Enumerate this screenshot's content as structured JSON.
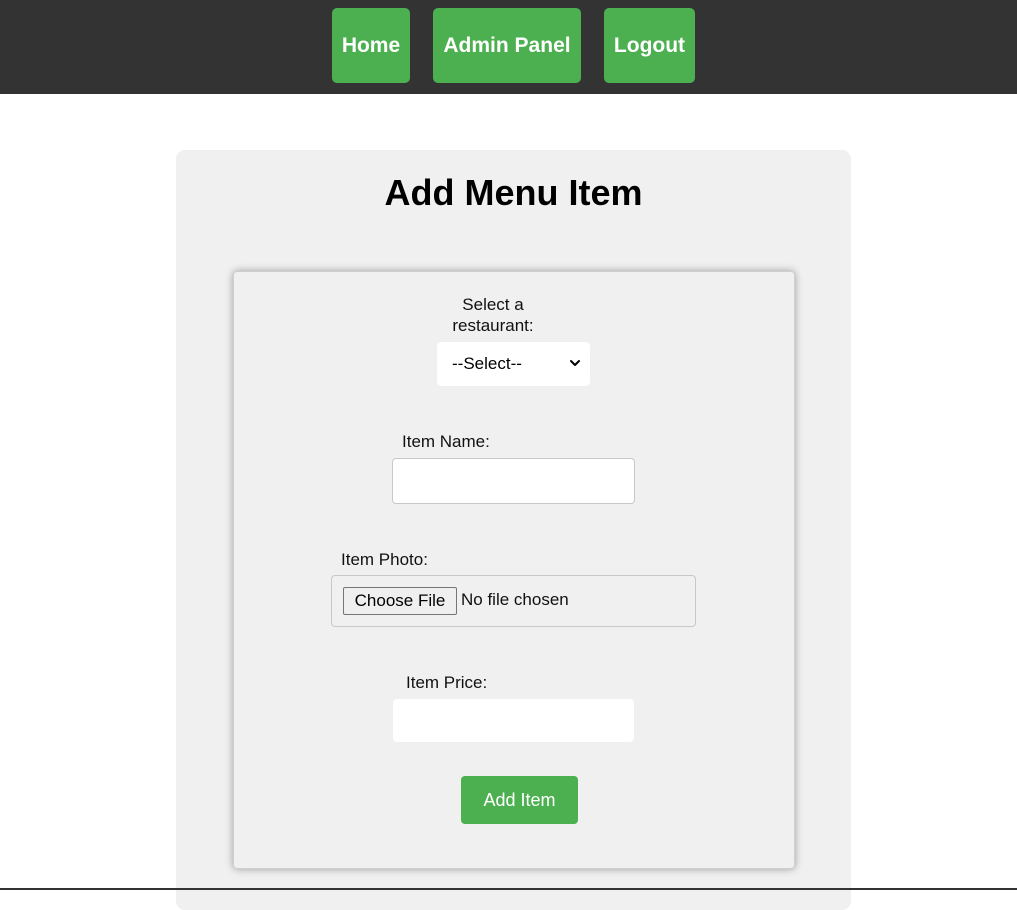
{
  "nav": {
    "items": [
      {
        "label": "Home"
      },
      {
        "label": "Admin Panel"
      },
      {
        "label": "Logout"
      }
    ],
    "accent_color": "#4caf50",
    "background_color": "#333333"
  },
  "main": {
    "title": "Add Menu Item"
  },
  "form": {
    "restaurant_label": "Select a restaurant:",
    "restaurant_select_value": "--Select--",
    "item_name_label": "Item Name:",
    "item_name_value": "",
    "item_photo_label": "Item Photo:",
    "choose_file_label": "Choose File",
    "file_status": "No file chosen",
    "item_price_label": "Item Price:",
    "item_price_value": "",
    "submit_label": "Add Item"
  },
  "icons": {
    "select_chevron": "chevron-down-icon"
  }
}
